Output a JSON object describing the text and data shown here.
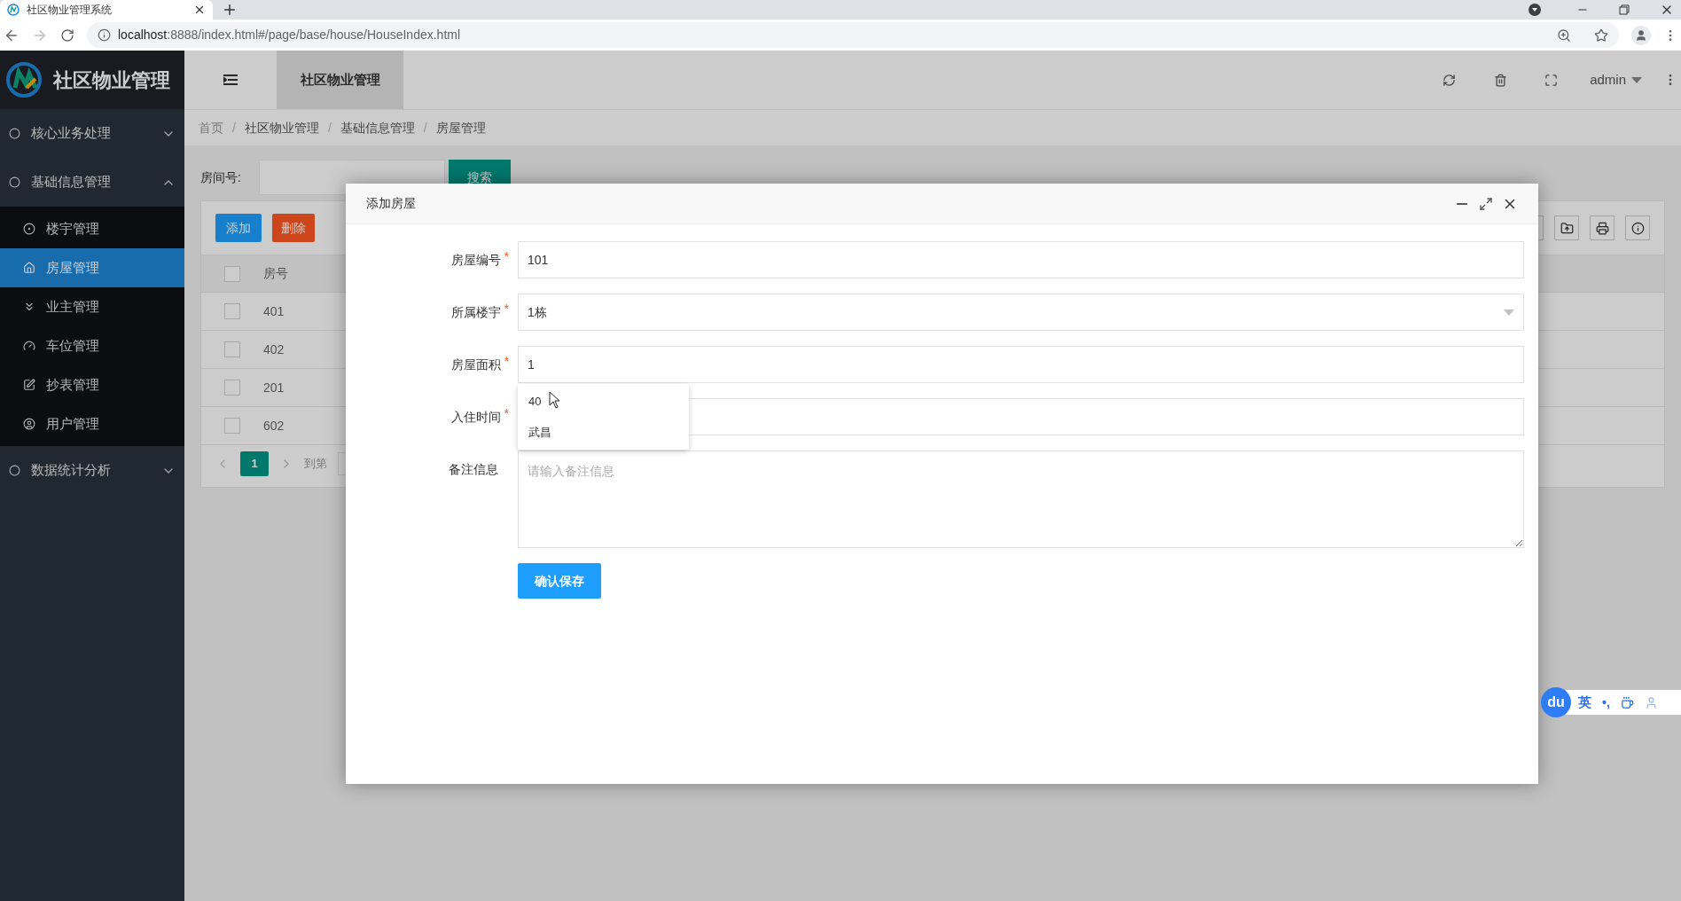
{
  "browser": {
    "tab_title": "社区物业管理系统",
    "url_host": "localhost",
    "url_rest": ":8888/index.html#/page/base/house/HouseIndex.html"
  },
  "app": {
    "brand": "社区物业管理",
    "header_tab": "社区物业管理",
    "user": "admin"
  },
  "sidebar": [
    {
      "label": "核心业务处理",
      "expanded": false
    },
    {
      "label": "基础信息管理",
      "expanded": true,
      "children": [
        {
          "label": "楼宇管理",
          "selected": false
        },
        {
          "label": "房屋管理",
          "selected": true
        },
        {
          "label": "业主管理",
          "selected": false
        },
        {
          "label": "车位管理",
          "selected": false
        },
        {
          "label": "抄表管理",
          "selected": false
        },
        {
          "label": "用户管理",
          "selected": false
        }
      ]
    },
    {
      "label": "数据统计分析",
      "expanded": false
    }
  ],
  "breadcrumb": {
    "separator": "/",
    "items": [
      "首页",
      "社区物业管理",
      "基础信息管理",
      "房屋管理"
    ]
  },
  "search": {
    "label": "房间号:",
    "button": "搜索"
  },
  "toolbar": {
    "add": "添加",
    "delete": "删除"
  },
  "table": {
    "select_all_checked": false,
    "columns": [
      "房号"
    ],
    "rows": [
      {
        "checked": false,
        "cells": [
          "401"
        ]
      },
      {
        "checked": false,
        "cells": [
          "402"
        ]
      },
      {
        "checked": false,
        "cells": [
          "201"
        ]
      },
      {
        "checked": false,
        "cells": [
          "602"
        ]
      }
    ]
  },
  "pagination": {
    "page": "1",
    "goto": "到第"
  },
  "dialog": {
    "title": "添加房屋",
    "required_mark": "*",
    "fields": [
      {
        "label": "房屋编号",
        "required": true,
        "kind": "text",
        "value": "101"
      },
      {
        "label": "所属楼宇",
        "required": true,
        "kind": "select",
        "value": "1栋"
      },
      {
        "label": "房屋面积",
        "required": true,
        "kind": "text",
        "value": "1"
      },
      {
        "label": "入住时间",
        "required": true,
        "kind": "text"
      },
      {
        "label": "备注信息",
        "required": false,
        "kind": "textarea",
        "placeholder": "请输入备注信息"
      }
    ],
    "submit": "确认保存"
  },
  "autocomplete": [
    "40",
    "武昌"
  ],
  "ime": {
    "logo": "du",
    "mode": "英",
    "punct": "•,"
  }
}
